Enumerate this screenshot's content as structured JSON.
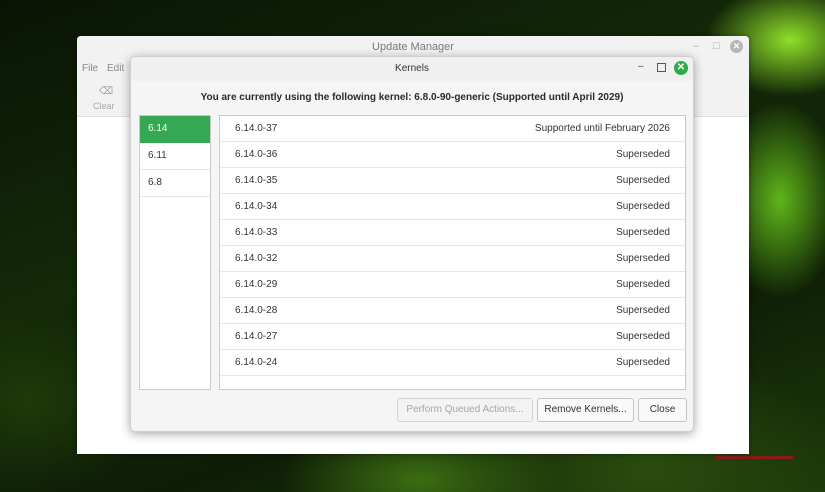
{
  "parent_window": {
    "title": "Update Manager",
    "controls": {
      "minimize": "–",
      "maximize": "□",
      "close": "✕"
    },
    "menu": [
      "File",
      "Edit"
    ],
    "toolbar": {
      "clear_label": "Clear",
      "clear_icon": "backspace-icon"
    }
  },
  "dialog": {
    "title": "Kernels",
    "controls": {
      "minimize": "–",
      "close": "✕"
    },
    "current_kernel_text": "You are currently using the following kernel: 6.8.0-90-generic (Supported until April 2029)",
    "series": [
      {
        "label": "6.14",
        "selected": true
      },
      {
        "label": "6.11",
        "selected": false
      },
      {
        "label": "6.8",
        "selected": false
      }
    ],
    "kernels": [
      {
        "version": "6.14.0-37",
        "status": "Supported until February 2026"
      },
      {
        "version": "6.14.0-36",
        "status": "Superseded"
      },
      {
        "version": "6.14.0-35",
        "status": "Superseded"
      },
      {
        "version": "6.14.0-34",
        "status": "Superseded"
      },
      {
        "version": "6.14.0-33",
        "status": "Superseded"
      },
      {
        "version": "6.14.0-32",
        "status": "Superseded"
      },
      {
        "version": "6.14.0-29",
        "status": "Superseded"
      },
      {
        "version": "6.14.0-28",
        "status": "Superseded"
      },
      {
        "version": "6.14.0-27",
        "status": "Superseded"
      },
      {
        "version": "6.14.0-24",
        "status": "Superseded"
      }
    ],
    "buttons": {
      "perform": "Perform Queued Actions...",
      "remove": "Remove Kernels...",
      "close": "Close"
    }
  },
  "colors": {
    "selected": "#35a853",
    "close_button": "#2eaa48"
  }
}
